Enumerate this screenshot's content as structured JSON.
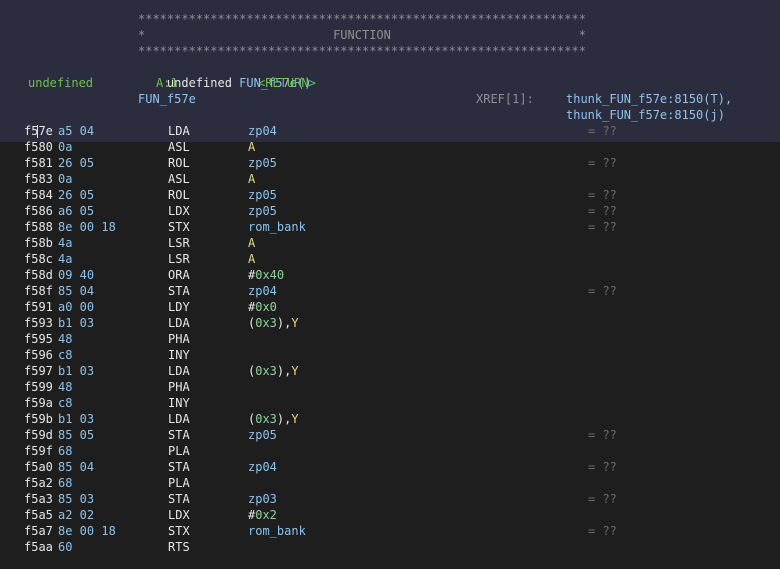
{
  "header": {
    "stars_line": "**************************************************************",
    "function_line": "*                          FUNCTION                          *",
    "signature_type": "undefined",
    "signature_name": "FUN_f57e()",
    "return_type": "undefined",
    "return_storage": "A:1",
    "return_name": "<RETURN>",
    "label": "FUN_f57e",
    "xref_label": "XREF[1]:",
    "xref_1": "thunk_FUN_f57e:8150(T),",
    "xref_2": "thunk_FUN_f57e:8150(j)"
  },
  "rows": [
    {
      "addr": "f57e",
      "bytes": "a5 04",
      "mn": "LDA",
      "op": [
        {
          "t": "zp04",
          "c": "blue"
        }
      ],
      "cm": "= ??"
    },
    {
      "addr": "f580",
      "bytes": "0a",
      "mn": "ASL",
      "op": [
        {
          "t": "A",
          "c": "yellow"
        }
      ],
      "cm": ""
    },
    {
      "addr": "f581",
      "bytes": "26 05",
      "mn": "ROL",
      "op": [
        {
          "t": "zp05",
          "c": "blue"
        }
      ],
      "cm": "= ??"
    },
    {
      "addr": "f583",
      "bytes": "0a",
      "mn": "ASL",
      "op": [
        {
          "t": "A",
          "c": "yellow"
        }
      ],
      "cm": ""
    },
    {
      "addr": "f584",
      "bytes": "26 05",
      "mn": "ROL",
      "op": [
        {
          "t": "zp05",
          "c": "blue"
        }
      ],
      "cm": "= ??"
    },
    {
      "addr": "f586",
      "bytes": "a6 05",
      "mn": "LDX",
      "op": [
        {
          "t": "zp05",
          "c": "blue"
        }
      ],
      "cm": "= ??"
    },
    {
      "addr": "f588",
      "bytes": "8e 00 18",
      "mn": "STX",
      "op": [
        {
          "t": "rom_bank",
          "c": "blue"
        }
      ],
      "cm": "= ??"
    },
    {
      "addr": "f58b",
      "bytes": "4a",
      "mn": "LSR",
      "op": [
        {
          "t": "A",
          "c": "yellow"
        }
      ],
      "cm": ""
    },
    {
      "addr": "f58c",
      "bytes": "4a",
      "mn": "LSR",
      "op": [
        {
          "t": "A",
          "c": "yellow"
        }
      ],
      "cm": ""
    },
    {
      "addr": "f58d",
      "bytes": "09 40",
      "mn": "ORA",
      "op": [
        {
          "t": "#",
          "c": "white"
        },
        {
          "t": "0x40",
          "c": "num"
        }
      ],
      "cm": ""
    },
    {
      "addr": "f58f",
      "bytes": "85 04",
      "mn": "STA",
      "op": [
        {
          "t": "zp04",
          "c": "blue"
        }
      ],
      "cm": "= ??"
    },
    {
      "addr": "f591",
      "bytes": "a0 00",
      "mn": "LDY",
      "op": [
        {
          "t": "#",
          "c": "white"
        },
        {
          "t": "0x0",
          "c": "num"
        }
      ],
      "cm": ""
    },
    {
      "addr": "f593",
      "bytes": "b1 03",
      "mn": "LDA",
      "op": [
        {
          "t": "(",
          "c": "white"
        },
        {
          "t": "0x3",
          "c": "num"
        },
        {
          "t": "),",
          "c": "white"
        },
        {
          "t": "Y",
          "c": "yellow"
        }
      ],
      "cm": ""
    },
    {
      "addr": "f595",
      "bytes": "48",
      "mn": "PHA",
      "op": [],
      "cm": ""
    },
    {
      "addr": "f596",
      "bytes": "c8",
      "mn": "INY",
      "op": [],
      "cm": ""
    },
    {
      "addr": "f597",
      "bytes": "b1 03",
      "mn": "LDA",
      "op": [
        {
          "t": "(",
          "c": "white"
        },
        {
          "t": "0x3",
          "c": "num"
        },
        {
          "t": "),",
          "c": "white"
        },
        {
          "t": "Y",
          "c": "yellow"
        }
      ],
      "cm": ""
    },
    {
      "addr": "f599",
      "bytes": "48",
      "mn": "PHA",
      "op": [],
      "cm": ""
    },
    {
      "addr": "f59a",
      "bytes": "c8",
      "mn": "INY",
      "op": [],
      "cm": ""
    },
    {
      "addr": "f59b",
      "bytes": "b1 03",
      "mn": "LDA",
      "op": [
        {
          "t": "(",
          "c": "white"
        },
        {
          "t": "0x3",
          "c": "num"
        },
        {
          "t": "),",
          "c": "white"
        },
        {
          "t": "Y",
          "c": "yellow"
        }
      ],
      "cm": ""
    },
    {
      "addr": "f59d",
      "bytes": "85 05",
      "mn": "STA",
      "op": [
        {
          "t": "zp05",
          "c": "blue"
        }
      ],
      "cm": "= ??"
    },
    {
      "addr": "f59f",
      "bytes": "68",
      "mn": "PLA",
      "op": [],
      "cm": ""
    },
    {
      "addr": "f5a0",
      "bytes": "85 04",
      "mn": "STA",
      "op": [
        {
          "t": "zp04",
          "c": "blue"
        }
      ],
      "cm": "= ??"
    },
    {
      "addr": "f5a2",
      "bytes": "68",
      "mn": "PLA",
      "op": [],
      "cm": ""
    },
    {
      "addr": "f5a3",
      "bytes": "85 03",
      "mn": "STA",
      "op": [
        {
          "t": "zp03",
          "c": "blue"
        }
      ],
      "cm": "= ??"
    },
    {
      "addr": "f5a5",
      "bytes": "a2 02",
      "mn": "LDX",
      "op": [
        {
          "t": "#",
          "c": "white"
        },
        {
          "t": "0x2",
          "c": "num"
        }
      ],
      "cm": ""
    },
    {
      "addr": "f5a7",
      "bytes": "8e 00 18",
      "mn": "STX",
      "op": [
        {
          "t": "rom_bank",
          "c": "blue"
        }
      ],
      "cm": "= ??"
    },
    {
      "addr": "f5aa",
      "bytes": "60",
      "mn": "RTS",
      "op": [],
      "cm": ""
    }
  ]
}
